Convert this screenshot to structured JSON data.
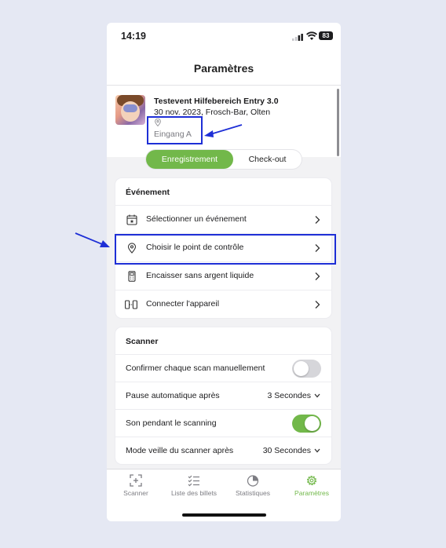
{
  "status_bar": {
    "time": "14:19",
    "battery": "83",
    "icons": [
      "signal-icon",
      "wifi-icon",
      "battery-icon"
    ]
  },
  "header": {
    "title": "Paramètres"
  },
  "event": {
    "title": "Testevent Hilfebereich Entry 3.0",
    "subtitle": "30 nov. 2023, Frosch-Bar, Olten",
    "gate": "Eingang A",
    "gate_icon": "location-pin-icon"
  },
  "mode_switch": {
    "active": "Enregistrement",
    "inactive": "Check-out"
  },
  "event_section": {
    "title": "Événement",
    "items": [
      {
        "label": "Sélectionner un événement",
        "icon": "calendar-star-icon"
      },
      {
        "label": "Choisir le point de contrôle",
        "icon": "location-pin-icon"
      },
      {
        "label": "Encaisser sans argent liquide",
        "icon": "terminal-icon"
      },
      {
        "label": "Connecter l'appareil",
        "icon": "device-link-icon"
      }
    ]
  },
  "scanner_section": {
    "title": "Scanner",
    "items": [
      {
        "label": "Confirmer chaque scan manuellement",
        "toggle": false
      },
      {
        "label": "Pause automatique après",
        "value": "3 Secondes"
      },
      {
        "label": "Son pendant le scanning",
        "toggle": true
      },
      {
        "label": "Mode veille du scanner après",
        "value": "30 Secondes"
      }
    ]
  },
  "tabbar": {
    "tabs": [
      {
        "label": "Scanner",
        "icon": "scan-icon"
      },
      {
        "label": "Liste des billets",
        "icon": "list-icon"
      },
      {
        "label": "Statistiques",
        "icon": "pie-chart-icon"
      },
      {
        "label": "Paramètres",
        "icon": "gear-icon",
        "active": true
      }
    ]
  },
  "colors": {
    "accent": "#72b84a",
    "highlight": "#1e2fd6",
    "background": "#e5e8f3"
  }
}
